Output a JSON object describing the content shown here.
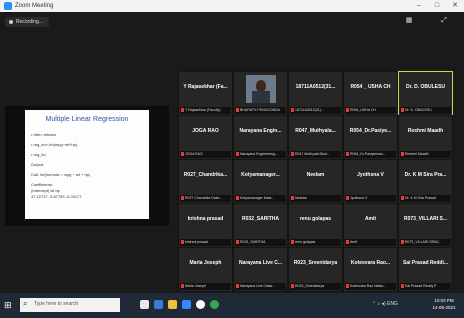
{
  "window": {
    "title": "Zoom Meeting",
    "controls": [
      "–",
      "□",
      "✕"
    ]
  },
  "meeting": {
    "recording_label": "Recording..."
  },
  "slide": {
    "title": "Multiple Linear Regression",
    "lines": [
      "• dfm<-mtcars",
      "• reg_lm<-lm(mpg~wt+hp)",
      "• reg_lm",
      "Output:",
      "Call: lm(formula = mpg ~ wt + hp)",
      "Coefficients:",
      "(Intercept)      wt        hp",
      "  37.22727  -3.87783  -0.03177"
    ]
  },
  "participants": [
    {
      "name": "Y Rajasekhar (Fa...",
      "label": "Y Rajasekhar (Faculty)"
    },
    {
      "name": "",
      "label": "BHARATH PENUGONDA",
      "video": true
    },
    {
      "name": "18711A0512(31...",
      "label": "18711A0512(31)..."
    },
    {
      "name": "R054 _ USHA CH",
      "label": "R054_USHA CH"
    },
    {
      "name": "Dr. D. OBULESU",
      "label": "Dr. D. OBULESU",
      "active": true
    },
    {
      "name": "JOGA RAO",
      "label": "JOGA RAO"
    },
    {
      "name": "Narayana Engin...",
      "label": "Narayana Engineering..."
    },
    {
      "name": "R047_Muthyala...",
      "label": "R047 Muthyala Bind..."
    },
    {
      "name": "R054_Dr.Pasiye...",
      "label": "R054_Dr.Pasiyemaru..."
    },
    {
      "name": "Reshmi Maadh",
      "label": "Reshmi Maadh"
    },
    {
      "name": "R027_Chandrika...",
      "label": "R027 Chandrika Dash..."
    },
    {
      "name": "Kotyamanager...",
      "label": "Kotyamanager Mala..."
    },
    {
      "name": "Neelam",
      "label": "Neelam"
    },
    {
      "name": "Jyothsna V",
      "label": "Jyothsna V"
    },
    {
      "name": "Dr. K M Sira Pra...",
      "label": "Dr. K M Sira Prasad"
    },
    {
      "name": "krishna prasad",
      "label": "krishna prasad"
    },
    {
      "name": "R032_SARITHA",
      "label": "R032_SARITHA"
    },
    {
      "name": "renu golapas",
      "label": "renu golapas"
    },
    {
      "name": "Amit",
      "label": "Amit"
    },
    {
      "name": "R073_VILLARI S...",
      "label": "R073_VILLARI SRAV..."
    },
    {
      "name": "Maria Joseph",
      "label": "Maria Joseph"
    },
    {
      "name": "Narayana Live C...",
      "label": "Narayana Live Class..."
    },
    {
      "name": "R023_Sreenidarya",
      "label": "R023_Sreenidarya"
    },
    {
      "name": "Kotesvara Rao...",
      "label": "Kotesvara Rao Naidu..."
    },
    {
      "name": "Sai Prasad Reddi...",
      "label": "Sai Prasad Reddy P"
    }
  ],
  "taskbar": {
    "search_placeholder": "Type here to search",
    "time": "10:03 PM",
    "date": "14-06-2021"
  },
  "colors": {
    "active_border": "#c8d84a",
    "zoom_blue": "#2d8cff",
    "muted_red": "#e23b3b"
  }
}
